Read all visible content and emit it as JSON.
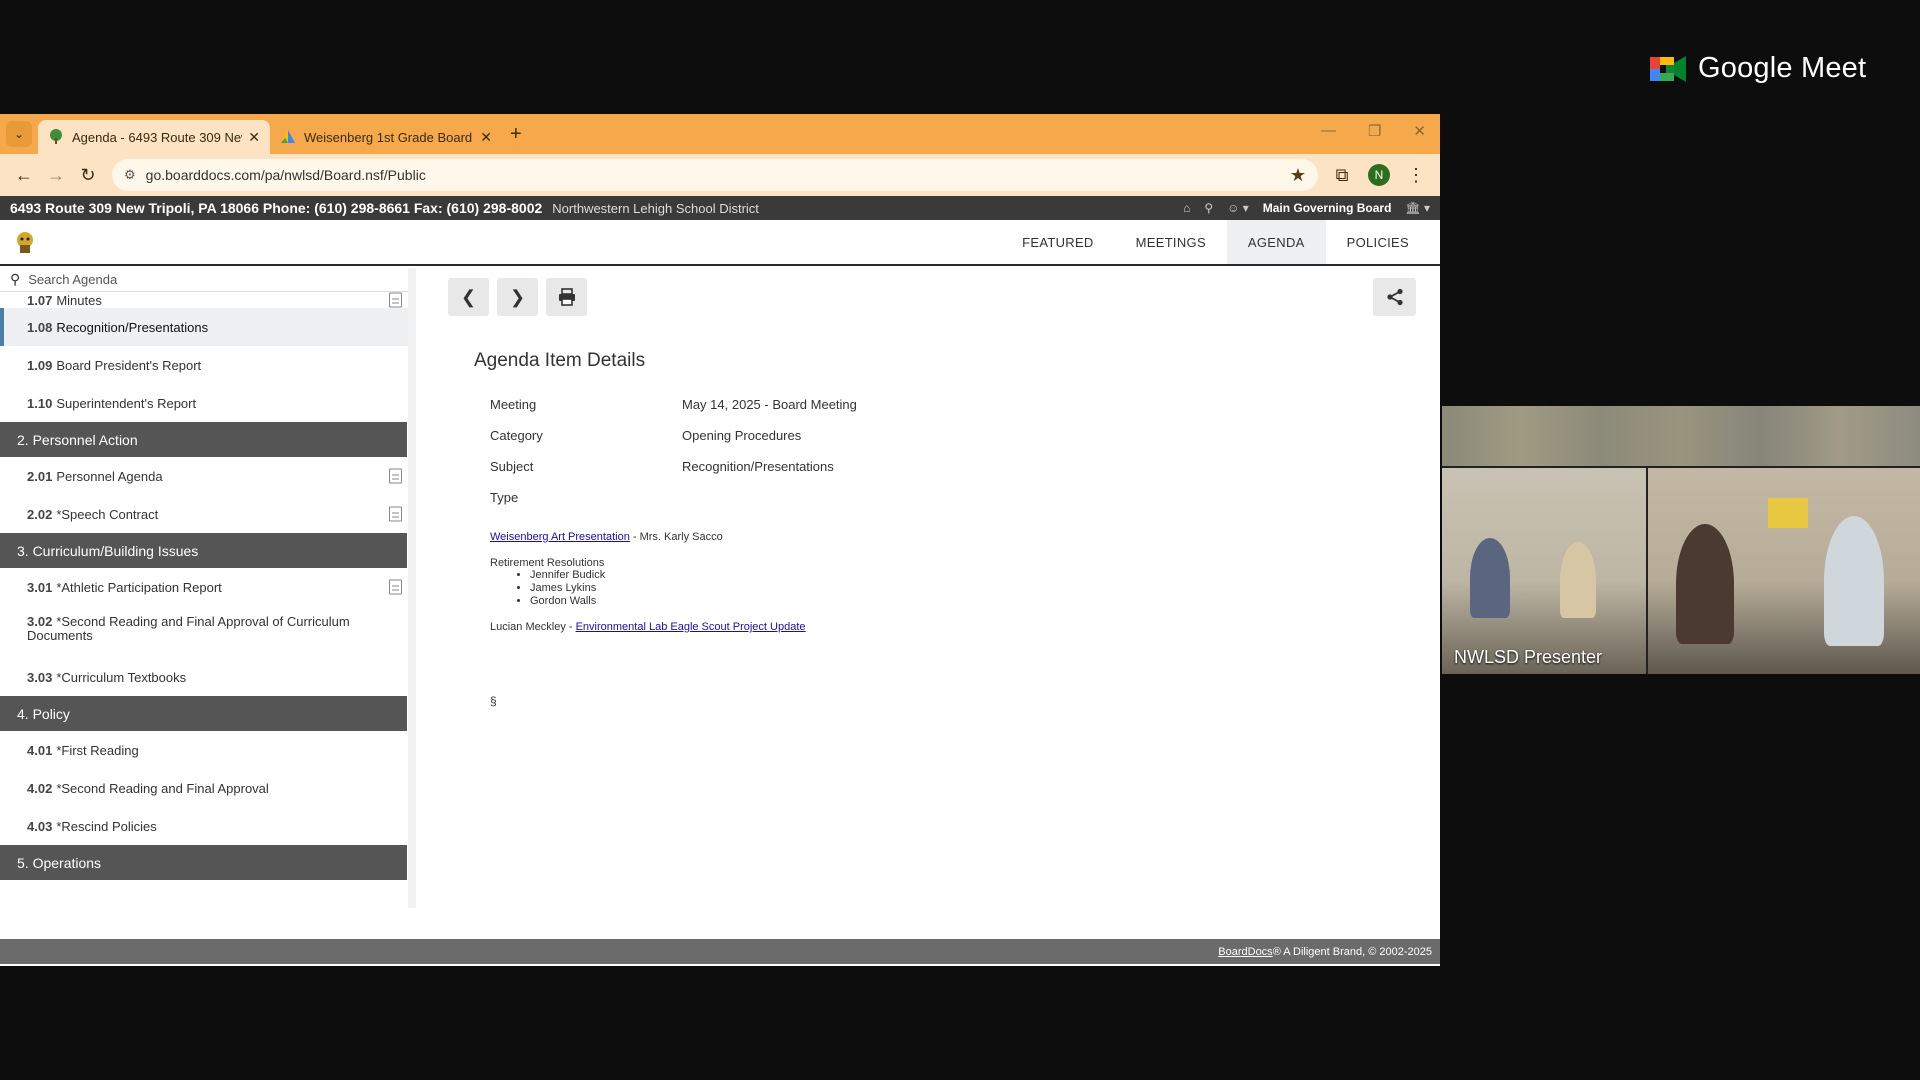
{
  "meet": {
    "brand": "Google Meet",
    "presenter_name": "NWLSD Presenter"
  },
  "browser": {
    "tabs": [
      {
        "title": "Agenda - 6493 Route 309 New",
        "active": true
      },
      {
        "title": "Weisenberg 1st Grade Board P",
        "active": false
      }
    ],
    "url": "go.boarddocs.com/pa/nwlsd/Board.nsf/Public",
    "profile_initial": "N"
  },
  "boarddocs": {
    "address": "6493 Route 309 New Tripoli, PA 18066 Phone: (610) 298-8661 Fax: (610) 298-8002",
    "district": "Northwestern Lehigh School District",
    "board": "Main Governing Board",
    "nav": [
      "FEATURED",
      "MEETINGS",
      "AGENDA",
      "POLICIES"
    ],
    "active_nav": "AGENDA",
    "search_placeholder": "Search Agenda"
  },
  "sidebar": {
    "items": [
      {
        "num": "1.07",
        "label": "Minutes",
        "doc": true
      },
      {
        "num": "1.08",
        "label": "Recognition/Presentations",
        "active": true
      },
      {
        "num": "1.09",
        "label": "Board President's Report"
      },
      {
        "num": "1.10",
        "label": "Superintendent's Report"
      },
      {
        "section": "2. Personnel Action"
      },
      {
        "num": "2.01",
        "label": "Personnel Agenda",
        "doc": true
      },
      {
        "num": "2.02",
        "label": "*Speech Contract",
        "doc": true
      },
      {
        "section": "3. Curriculum/Building Issues"
      },
      {
        "num": "3.01",
        "label": "*Athletic Participation Report",
        "doc": true
      },
      {
        "num": "3.02",
        "label": "*Second Reading and Final Approval of Curriculum Documents",
        "twoline": true
      },
      {
        "num": "3.03",
        "label": "*Curriculum Textbooks"
      },
      {
        "section": "4. Policy"
      },
      {
        "num": "4.01",
        "label": "*First Reading"
      },
      {
        "num": "4.02",
        "label": "*Second Reading and Final Approval"
      },
      {
        "num": "4.03",
        "label": "*Rescind Policies"
      },
      {
        "section": "5. Operations"
      }
    ]
  },
  "details": {
    "title": "Agenda Item Details",
    "fields": [
      {
        "key": "Meeting",
        "value": "May 14, 2025 - Board Meeting"
      },
      {
        "key": "Category",
        "value": "Opening Procedures"
      },
      {
        "key": "Subject",
        "value": "Recognition/Presentations"
      },
      {
        "key": "Type",
        "value": ""
      }
    ],
    "art_link": "Weisenberg Art Presentation",
    "art_suffix": " - Mrs. Karly Sacco",
    "retirement_heading": "Retirement Resolutions",
    "retirees": [
      "Jennifer Budick",
      "James Lykins",
      "Gordon Walls"
    ],
    "scout_prefix": "Lucian Meckley - ",
    "scout_link": "Environmental Lab Eagle Scout Project Update",
    "section_mark": "§"
  },
  "footer": {
    "brand_link": "BoardDocs",
    "text": "® A Diligent Brand, © 2002-2025"
  }
}
